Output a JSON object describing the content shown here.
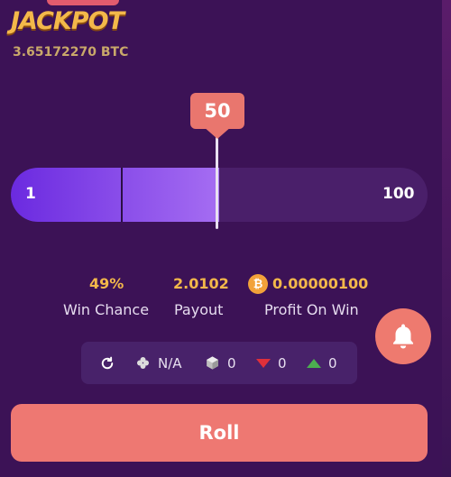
{
  "jackpot": {
    "title": "JACKPOT",
    "amount": "3.65172270 BTC"
  },
  "slider": {
    "min_label": "1",
    "max_label": "100",
    "value": "50",
    "value_fraction": 0.5
  },
  "stats": {
    "win_chance_value": "49%",
    "win_chance_label": "Win Chance",
    "payout_value": "2.0102",
    "payout_label": "Payout",
    "profit_value": "0.00000100",
    "profit_label": "Profit On Win",
    "coin_icon": "bitcoin-icon"
  },
  "info_bar": {
    "refresh_icon": "refresh-icon",
    "clover_icon": "clover-icon",
    "clover_value": "N/A",
    "cube_icon": "cube-icon",
    "cube_value": "0",
    "down_icon": "arrow-down-icon",
    "down_value": "0",
    "up_icon": "arrow-up-icon",
    "up_value": "0"
  },
  "roll_button": {
    "label": "Roll"
  },
  "colors": {
    "background": "#3c1256",
    "accent_gold": "#f3b84a",
    "coral": "#ee7872",
    "slider_fill": "#a56df2",
    "down_arrow": "#e0303a",
    "up_arrow": "#4caf50"
  }
}
